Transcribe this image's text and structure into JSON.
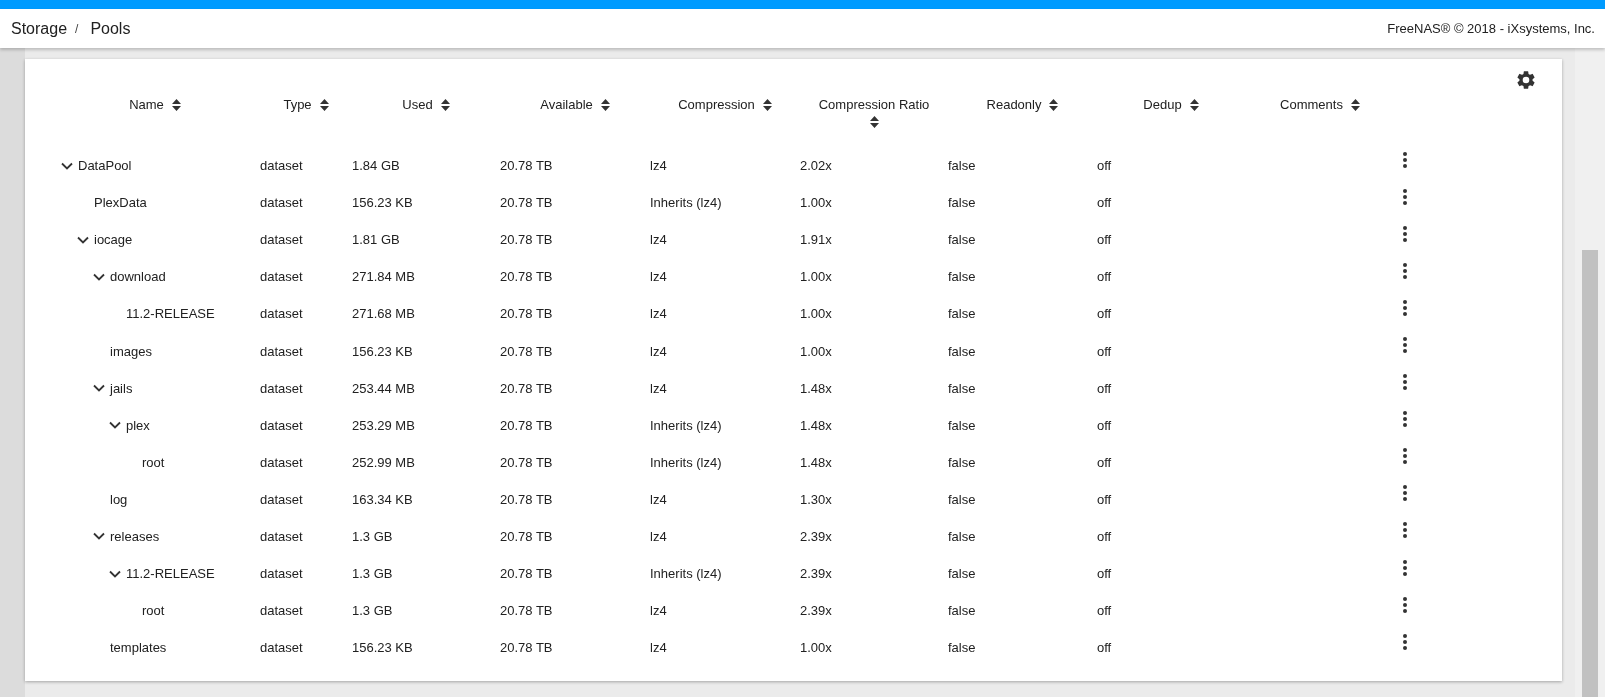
{
  "header": {
    "breadcrumb": [
      "Storage",
      "Pools"
    ],
    "separator": "/",
    "copyright": "FreeNAS® © 2018 - iXsystems, Inc."
  },
  "table": {
    "columns": [
      "Name",
      "Type",
      "Used",
      "Available",
      "Compression",
      "Compression Ratio",
      "Readonly",
      "Dedup",
      "Comments"
    ],
    "datasets": [
      {
        "name": "DataPool",
        "type": "dataset",
        "used": "1.84 GB",
        "available": "20.78 TB",
        "compression": "lz4",
        "ratio": "2.02x",
        "readonly": "false",
        "dedup": "off",
        "expanded": true,
        "children": [
          {
            "name": "PlexData",
            "type": "dataset",
            "used": "156.23 KB",
            "available": "20.78 TB",
            "compression": "Inherits (lz4)",
            "ratio": "1.00x",
            "readonly": "false",
            "dedup": "off"
          },
          {
            "name": "iocage",
            "type": "dataset",
            "used": "1.81 GB",
            "available": "20.78 TB",
            "compression": "lz4",
            "ratio": "1.91x",
            "readonly": "false",
            "dedup": "off",
            "expanded": true,
            "children": [
              {
                "name": "download",
                "type": "dataset",
                "used": "271.84 MB",
                "available": "20.78 TB",
                "compression": "lz4",
                "ratio": "1.00x",
                "readonly": "false",
                "dedup": "off",
                "expanded": true,
                "children": [
                  {
                    "name": "11.2-RELEASE",
                    "type": "dataset",
                    "used": "271.68 MB",
                    "available": "20.78 TB",
                    "compression": "lz4",
                    "ratio": "1.00x",
                    "readonly": "false",
                    "dedup": "off"
                  }
                ]
              },
              {
                "name": "images",
                "type": "dataset",
                "used": "156.23 KB",
                "available": "20.78 TB",
                "compression": "lz4",
                "ratio": "1.00x",
                "readonly": "false",
                "dedup": "off"
              },
              {
                "name": "jails",
                "type": "dataset",
                "used": "253.44 MB",
                "available": "20.78 TB",
                "compression": "lz4",
                "ratio": "1.48x",
                "readonly": "false",
                "dedup": "off",
                "expanded": true,
                "children": [
                  {
                    "name": "plex",
                    "type": "dataset",
                    "used": "253.29 MB",
                    "available": "20.78 TB",
                    "compression": "Inherits (lz4)",
                    "ratio": "1.48x",
                    "readonly": "false",
                    "dedup": "off",
                    "expanded": true,
                    "children": [
                      {
                        "name": "root",
                        "type": "dataset",
                        "used": "252.99 MB",
                        "available": "20.78 TB",
                        "compression": "Inherits (lz4)",
                        "ratio": "1.48x",
                        "readonly": "false",
                        "dedup": "off"
                      }
                    ]
                  }
                ]
              },
              {
                "name": "log",
                "type": "dataset",
                "used": "163.34 KB",
                "available": "20.78 TB",
                "compression": "lz4",
                "ratio": "1.30x",
                "readonly": "false",
                "dedup": "off"
              },
              {
                "name": "releases",
                "type": "dataset",
                "used": "1.3 GB",
                "available": "20.78 TB",
                "compression": "lz4",
                "ratio": "2.39x",
                "readonly": "false",
                "dedup": "off",
                "expanded": true,
                "children": [
                  {
                    "name": "11.2-RELEASE",
                    "type": "dataset",
                    "used": "1.3 GB",
                    "available": "20.78 TB",
                    "compression": "Inherits (lz4)",
                    "ratio": "2.39x",
                    "readonly": "false",
                    "dedup": "off",
                    "expanded": true,
                    "children": [
                      {
                        "name": "root",
                        "type": "dataset",
                        "used": "1.3 GB",
                        "available": "20.78 TB",
                        "compression": "lz4",
                        "ratio": "2.39x",
                        "readonly": "false",
                        "dedup": "off"
                      }
                    ]
                  }
                ]
              },
              {
                "name": "templates",
                "type": "dataset",
                "used": "156.23 KB",
                "available": "20.78 TB",
                "compression": "lz4",
                "ratio": "1.00x",
                "readonly": "false",
                "dedup": "off"
              }
            ]
          }
        ]
      }
    ]
  }
}
